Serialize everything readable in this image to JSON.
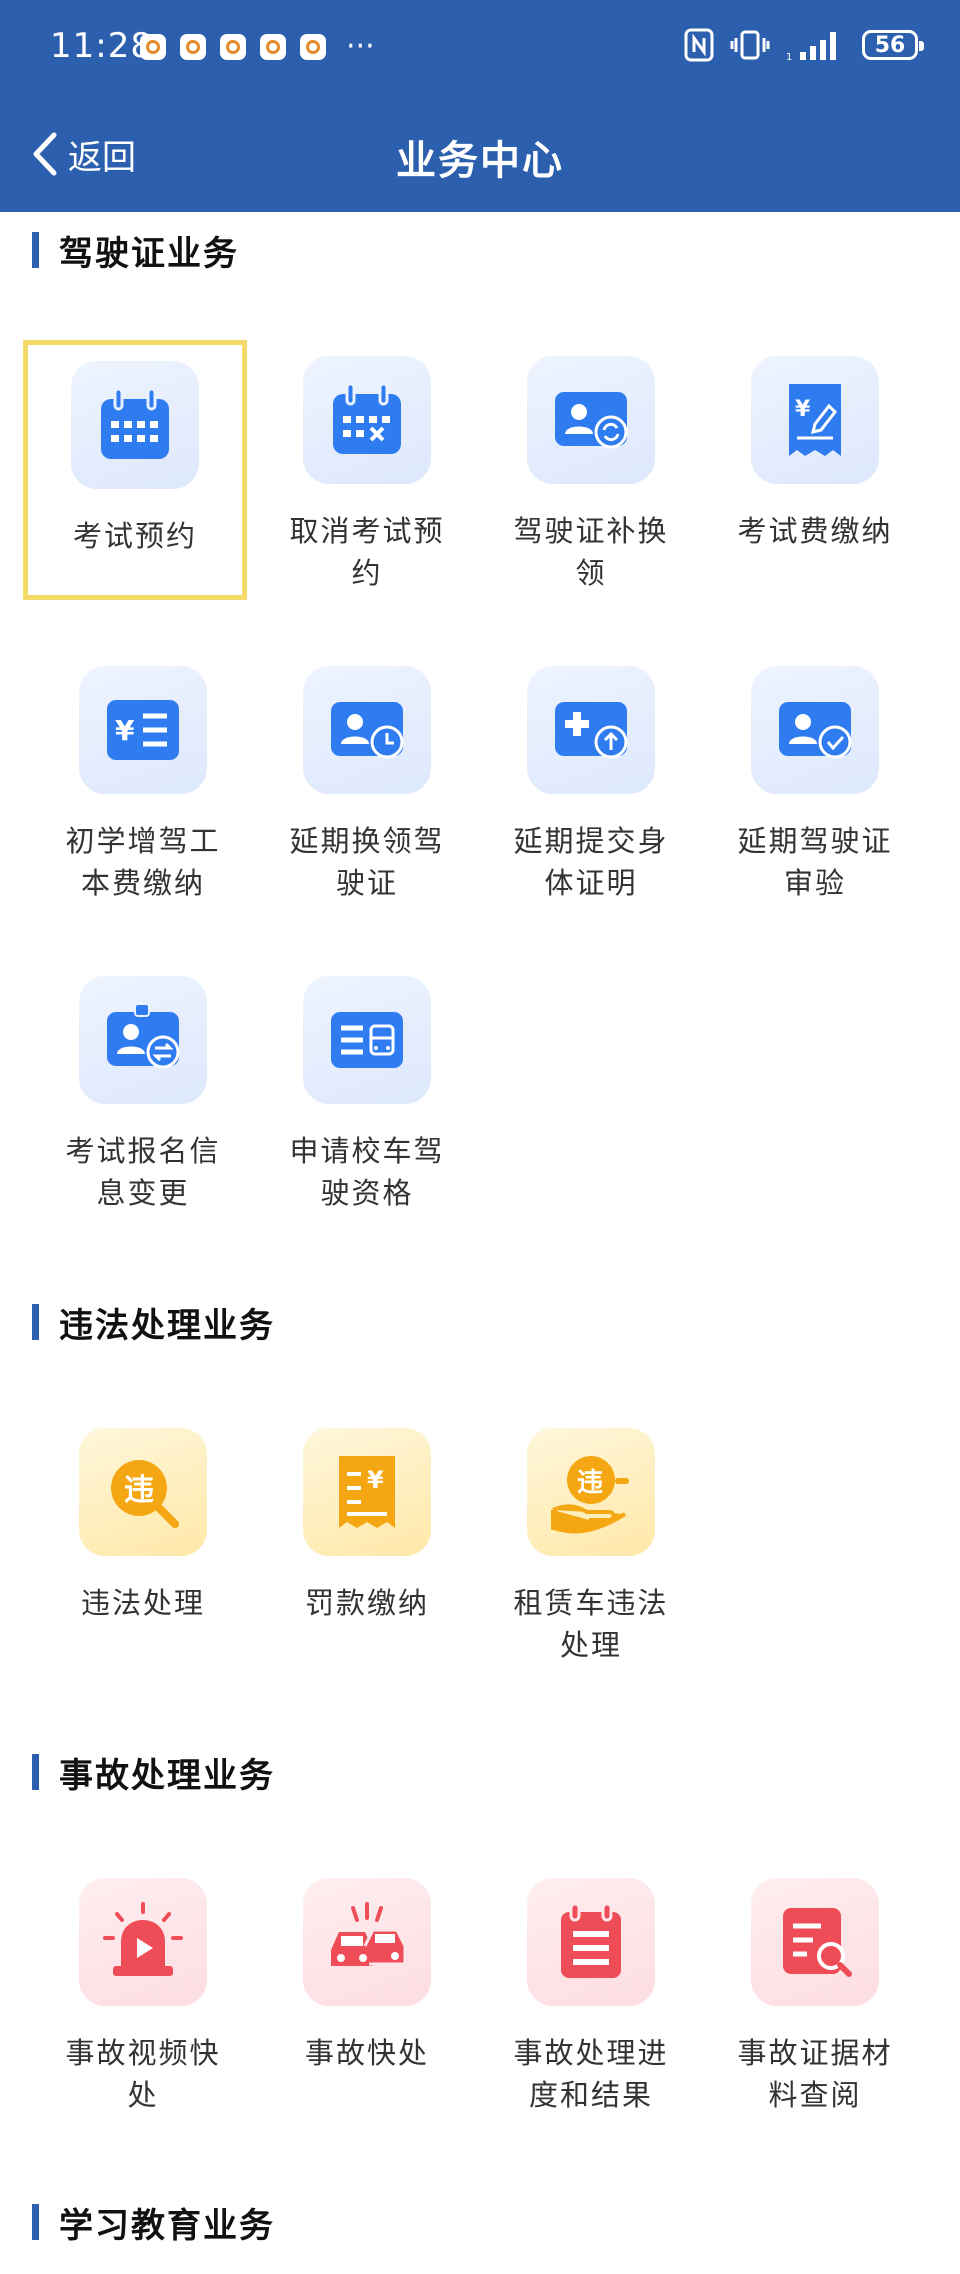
{
  "status": {
    "time": "11:28",
    "more": "···",
    "battery": "56"
  },
  "nav": {
    "back_label": "返回",
    "title": "业务中心"
  },
  "sections": [
    {
      "title": "驾驶证业务",
      "items": [
        {
          "label": "考试预约",
          "icon": "calendar-icon",
          "selected": true
        },
        {
          "label": "取消考试预约",
          "icon": "calendar-cancel-icon"
        },
        {
          "label": "驾驶证补换领",
          "icon": "id-card-refresh-icon"
        },
        {
          "label": "考试费缴纳",
          "icon": "fee-receipt-icon"
        },
        {
          "label": "初学增驾工本费缴纳",
          "icon": "yen-list-icon"
        },
        {
          "label": "延期换领驾驶证",
          "icon": "id-card-clock-icon"
        },
        {
          "label": "延期提交身体证明",
          "icon": "medical-upload-icon"
        },
        {
          "label": "延期驾驶证审验",
          "icon": "id-card-check-icon"
        },
        {
          "label": "考试报名信息变更",
          "icon": "id-card-swap-icon"
        },
        {
          "label": "申请校车驾驶资格",
          "icon": "school-bus-icon"
        }
      ]
    },
    {
      "title": "违法处理业务",
      "items": [
        {
          "label": "违法处理",
          "icon": "violation-search-icon"
        },
        {
          "label": "罚款缴纳",
          "icon": "fine-receipt-icon"
        },
        {
          "label": "租赁车违法处理",
          "icon": "violation-hand-icon"
        }
      ]
    },
    {
      "title": "事故处理业务",
      "items": [
        {
          "label": "事故视频快处",
          "icon": "siren-icon"
        },
        {
          "label": "事故快处",
          "icon": "car-crash-icon"
        },
        {
          "label": "事故处理进度和结果",
          "icon": "progress-clipboard-icon"
        },
        {
          "label": "事故证据材料查阅",
          "icon": "document-search-icon"
        }
      ]
    },
    {
      "title": "学习教育业务",
      "items": []
    }
  ],
  "colors": {
    "primary": "#2c5fae",
    "icon_blue": "#2f7cf0",
    "icon_yellow": "#f4a712",
    "icon_red": "#ee4d57",
    "highlight": "#f5da6a"
  }
}
